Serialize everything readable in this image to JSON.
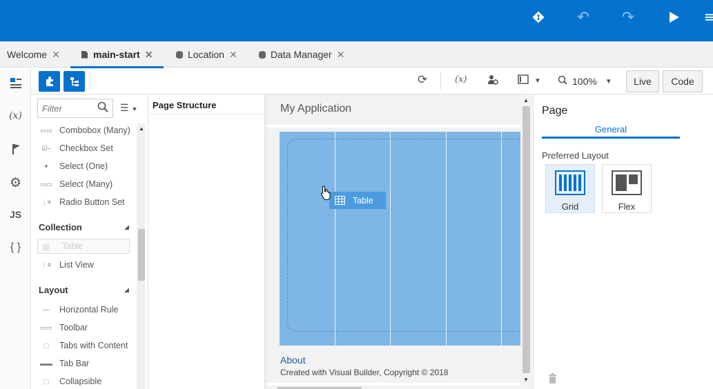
{
  "header": {
    "git_icon": "git-diamond-icon",
    "undo_icon": "undo-icon",
    "redo_icon": "redo-icon",
    "run_icon": "play-icon",
    "menu_icon": "menu-icon"
  },
  "tabs": [
    {
      "label": "Welcome",
      "icon": "none"
    },
    {
      "label": "main-start",
      "icon": "document-icon"
    },
    {
      "label": "Location",
      "icon": "database-icon"
    },
    {
      "label": "Data Manager",
      "icon": "database-icon"
    }
  ],
  "rail": {
    "components_icon": "components-icon",
    "variables_label": "(x)",
    "actions_icon": "flag-icon",
    "settings_icon": "gear-icon",
    "js_label": "JS",
    "json_label": "{ }"
  },
  "toolbar": {
    "zoom_value": "100%",
    "live_label": "Live",
    "code_label": "Code"
  },
  "palette": {
    "filter_placeholder": "Filter",
    "items_top": [
      "Combobox (Many)",
      "Checkbox Set",
      "Select (One)",
      "Select (Many)",
      "Radio Button Set"
    ],
    "collection_heading": "Collection",
    "collection_items": [
      "Table",
      "List View"
    ],
    "layout_heading": "Layout",
    "layout_items": [
      "Horizontal Rule",
      "Toolbar",
      "Tabs with Content",
      "Tab Bar",
      "Collapsible"
    ]
  },
  "structure": {
    "title": "Page Structure"
  },
  "canvas": {
    "app_title": "My Application",
    "drag_label": "Table",
    "footer_link": "About",
    "footer_text": "Created with Visual Builder, Copyright © 2018"
  },
  "properties": {
    "title": "Page",
    "tab_general": "General",
    "preferred_layout_label": "Preferred Layout",
    "layouts": [
      {
        "label": "Grid",
        "selected": true
      },
      {
        "label": "Flex",
        "selected": false
      }
    ]
  },
  "colors": {
    "brand_blue": "#0572ce",
    "grid_fill": "#7eb6e6"
  }
}
